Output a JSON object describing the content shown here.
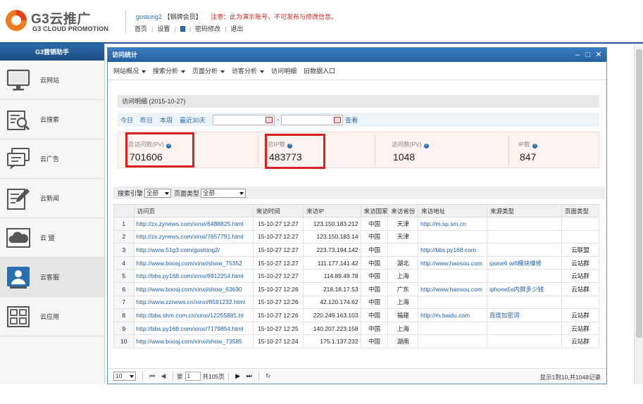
{
  "header": {
    "logo_main": "G3云推广",
    "logo_sub": "G3 CLOUD PROMOTION",
    "username": "gostong2",
    "member_level": "【钢牌会员】",
    "notice": "注意：此为演示账号，不可发布与修改信息。",
    "nav": {
      "home": "首页",
      "settings": "设置",
      "change_password": "密码修改",
      "logout": "退出"
    }
  },
  "sidebar": {
    "title": "G3营销助手",
    "items": [
      {
        "label": "云网站",
        "icon": "monitor-icon"
      },
      {
        "label": "云搜索",
        "icon": "search-document-icon"
      },
      {
        "label": "云广告",
        "icon": "chat-bubble-icon"
      },
      {
        "label": "云新闻",
        "icon": "edit-document-icon"
      },
      {
        "label": "云  盟",
        "icon": "cloud-icon"
      },
      {
        "label": "云客服",
        "icon": "customer-service-icon"
      },
      {
        "label": "云应用",
        "icon": "apps-icon"
      }
    ]
  },
  "panel": {
    "title": "访问统计",
    "menu": [
      {
        "label": "网站概况",
        "dropdown": true
      },
      {
        "label": "搜索分析",
        "dropdown": true
      },
      {
        "label": "页面分析",
        "dropdown": true
      },
      {
        "label": "访客分析",
        "dropdown": true
      },
      {
        "label": "访问明细",
        "dropdown": false
      },
      {
        "label": "旧数据入口",
        "dropdown": false
      }
    ]
  },
  "detail": {
    "title": "访问明细 (2015-10-27)"
  },
  "filter": {
    "today": "今日",
    "yesterday": "昨日",
    "this_week": "本周",
    "last30": "最近30天",
    "date_from": "",
    "date_to": "",
    "dash": "-",
    "view": "查看"
  },
  "stats": [
    {
      "label": "总访问数(PV)",
      "value": "701606"
    },
    {
      "label": "总IP数",
      "value": "483773"
    },
    {
      "label": "访问数(PV)",
      "value": "1048"
    },
    {
      "label": "IP数",
      "value": "847"
    }
  ],
  "search": {
    "engine_label": "搜索引擎",
    "engine_value": "全部",
    "page_type_label": "页面类型",
    "page_type_value": "全部"
  },
  "table": {
    "columns": [
      "访问页",
      "来访时间",
      "来访IP",
      "来访国家",
      "来访省份",
      "来访地址",
      "来源类型",
      "页面类型"
    ],
    "rows": [
      {
        "n": "1",
        "page": "http://zx.zynews.com/xinxi/6488825.html",
        "time": "15-10-27 12:27",
        "ip": "123.150.183.212",
        "country": "中国",
        "province": "天津",
        "from": "http://m.sp.sm.cn",
        "source": "",
        "ptype": ""
      },
      {
        "n": "2",
        "page": "http://zx.zynews.com/xinxi/7657791.html",
        "time": "15-10-27 12:27",
        "ip": "123.150.183.14",
        "country": "中国",
        "province": "天津",
        "from": "",
        "source": "",
        "ptype": ""
      },
      {
        "n": "3",
        "page": "http://www.51g3.com/gostong2/",
        "time": "15-10-27 12:27",
        "ip": "223.73.194.142",
        "country": "中国",
        "province": "",
        "from": "http://bbs.py168.com",
        "source": "",
        "ptype": "云联盟"
      },
      {
        "n": "4",
        "page": "http://www.boosj.com/xinxi/show_75352",
        "time": "15-10-27 12:27",
        "ip": "111.177.141.42",
        "country": "中国",
        "province": "湖北",
        "from": "http://www.haosou.com",
        "source": "ipone6 wifi模块维修",
        "ptype": "云站群"
      },
      {
        "n": "5",
        "page": "http://bbs.py168.com/xinxi/6912254.html",
        "time": "15-10-27 12:27",
        "ip": "114.89.49.78",
        "country": "中国",
        "province": "上海",
        "from": "",
        "source": "",
        "ptype": "云站群"
      },
      {
        "n": "6",
        "page": "http://www.boosj.com/xinxi/show_63630",
        "time": "15-10-27 12:26",
        "ip": "218.18.17.53",
        "country": "中国",
        "province": "广东",
        "from": "http://www.haosou.com",
        "source": "iphone5s内屏多少钱",
        "ptype": "云站群"
      },
      {
        "n": "7",
        "page": "http://www.zznews.cn/xinxi/8591232.html",
        "time": "15-10-27 12:26",
        "ip": "42.120.174.62",
        "country": "中国",
        "province": "上海",
        "from": "",
        "source": "",
        "ptype": ""
      },
      {
        "n": "8",
        "page": "http://bbs.shm.com.cn/xinxi/12255881.ht",
        "time": "15-10-27 12:26",
        "ip": "220.249.163.103",
        "country": "中国",
        "province": "福建",
        "from": "http://m.baidu.com",
        "source": "百度加密词",
        "ptype": "云站群"
      },
      {
        "n": "9",
        "page": "http://bbs.py168.com/xinxi/7179854.html",
        "time": "15-10-27 12:25",
        "ip": "140.207.223.158",
        "country": "中国",
        "province": "上海",
        "from": "",
        "source": "",
        "ptype": "云站群"
      },
      {
        "n": "10",
        "page": "http://www.boosj.com/xinxi/show_73585",
        "time": "15-10-27 12:24",
        "ip": "175.1.137.232",
        "country": "中国",
        "province": "湖南",
        "from": "",
        "source": "",
        "ptype": "云站群"
      }
    ]
  },
  "pager": {
    "page_size": "10",
    "page_label": "第",
    "page_value": "1",
    "total_pages": "共105页",
    "info": "显示1到10,共1048记录"
  },
  "colors": {
    "accent_blue": "#1f5a98",
    "link_blue": "#1f5fa8",
    "notice_red": "#d9211d",
    "logo_orange": "#f07a1c"
  }
}
